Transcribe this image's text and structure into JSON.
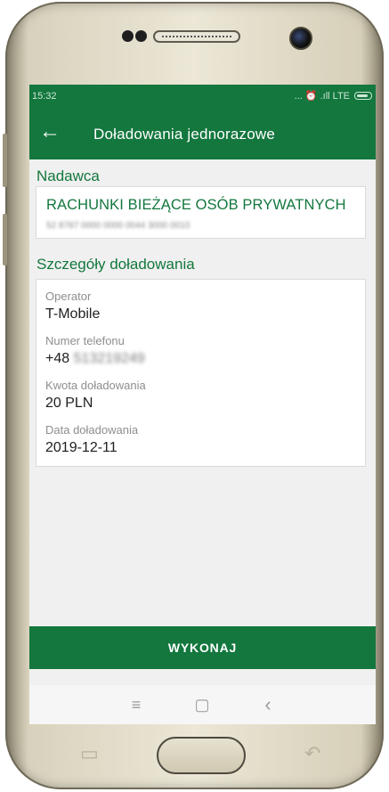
{
  "status_bar": {
    "time": "15:32",
    "indicators": "... ⏰ .ıll LTE"
  },
  "app_bar": {
    "back_icon": "arrow-left-icon",
    "back_glyph": "←",
    "title": "Doładowania jednorazowe"
  },
  "sender": {
    "section_title": "Nadawca",
    "account_name": "RACHUNKI BIEŻĄCE OSÓB PRYWATNYCH",
    "account_number": "52 8787 0000 0000 0044 3000 0010"
  },
  "details": {
    "section_title": "Szczegóły doładowania",
    "fields": [
      {
        "label": "Operator",
        "value": "T-Mobile"
      },
      {
        "label": "Numer telefonu",
        "prefix": "+48",
        "value": "513219249"
      },
      {
        "label": "Kwota doładowania",
        "value": "20 PLN"
      },
      {
        "label": "Data doładowania",
        "value": "2019-12-11"
      }
    ]
  },
  "actions": {
    "execute_label": "WYKONAJ"
  },
  "nav_bar": {
    "menu_glyph": "≡",
    "home_glyph": "▢",
    "back_glyph": "‹",
    "icons": [
      "menu-icon",
      "home-icon",
      "back-icon"
    ]
  },
  "hardware_keys": {
    "recent_glyph": "▭",
    "back_glyph": "↶"
  },
  "colors": {
    "brand_green": "#13773e",
    "background": "#f0f0f0",
    "card": "#ffffff",
    "label_gray": "#8e8e8e",
    "phone_gold": "#e4dec9"
  }
}
